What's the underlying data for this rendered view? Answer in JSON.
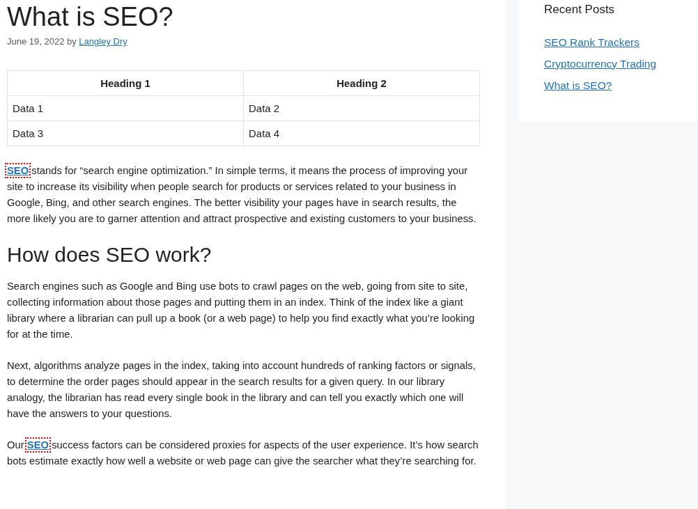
{
  "article": {
    "title": "What is SEO?",
    "meta": {
      "date_text": "June 19, 2022 by",
      "author": "Langley Dry"
    },
    "table": {
      "columns": [
        "Heading 1",
        "Heading 2"
      ],
      "rows": [
        [
          "Data 1",
          "Data 2"
        ],
        [
          "Data 3",
          "Data 4"
        ]
      ]
    },
    "blocks": [
      {
        "kind": "paragraph",
        "link": "SEO",
        "link_focused": true,
        "after": " stands for “search engine optimization.” In simple terms, it means the process of improving your site to increase its visibility when people search for products or services related to your business in Google, Bing, and other search engines. The better visibility your pages have in search results, the more likely you are to garner attention and attract prospective and existing customers to your business."
      },
      {
        "kind": "heading",
        "text": "How does SEO work?"
      },
      {
        "kind": "paragraph",
        "before": "Search engines such as Google and Bing use bots to crawl pages on the web, going from site to site, collecting information about those pages and putting them in an index. Think of the index like a giant library where a librarian can pull up a book (or a web page) to help you find exactly what you’re looking for at the time."
      },
      {
        "kind": "paragraph",
        "before": "Next, algorithms analyze pages in the index, taking into account hundreds of ranking factors or signals, to determine the order pages should appear in the search results for a given query. In our library analogy, the librarian has read every single book in the library and can tell you exactly which one will have the answers to your questions."
      },
      {
        "kind": "paragraph",
        "before": "Our ",
        "link": "SEO",
        "link_focused": true,
        "after": " success factors can be considered proxies for aspects of the user experience. It’s how search bots estimate exactly how well a website or web page can give the searcher what they’re searching for."
      }
    ]
  },
  "sidebar": {
    "title": "Recent Posts",
    "links": [
      "SEO Rank Trackers",
      "Cryptocurrency Trading",
      "What is SEO?"
    ]
  }
}
